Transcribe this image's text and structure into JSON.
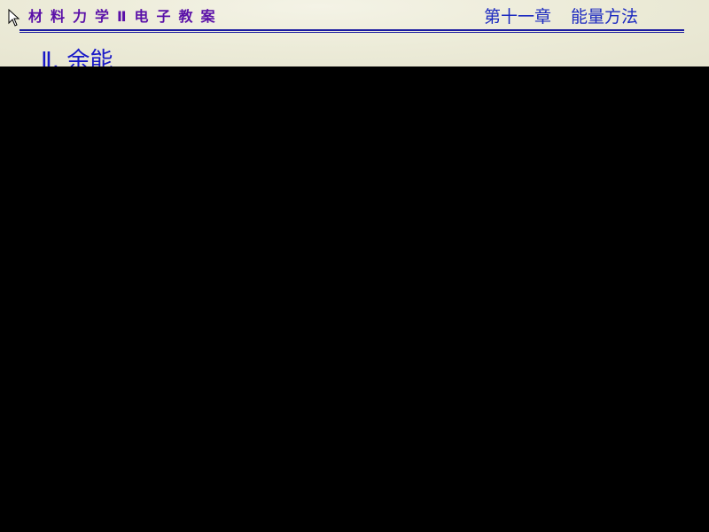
{
  "header": {
    "course_title": "材料力学Ⅱ电子教案",
    "chapter": "第十一章",
    "chapter_title": "能量方法"
  },
  "section": {
    "heading": "Ⅱ. 余能"
  },
  "colors": {
    "course_title": "#5a10a8",
    "chapter": "#1c2ac0",
    "rule": "#1a1aa0",
    "background": "#000000"
  }
}
